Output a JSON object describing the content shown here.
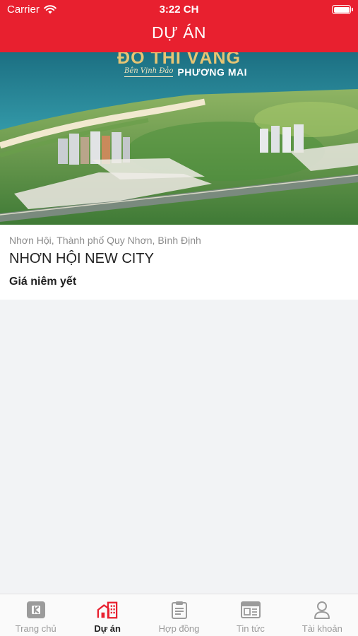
{
  "status_bar": {
    "carrier": "Carrier",
    "time": "3:22 CH"
  },
  "header": {
    "title": "DỰ ÁN"
  },
  "project": {
    "image_title": "ĐÔ THỊ VÀNG",
    "image_subtitle_script": "Bên Vịnh Đảo",
    "image_subtitle_name": "PHƯƠNG MAI",
    "location": "Nhơn Hội, Thành phố Quy Nhơn, Bình Định",
    "name": "NHƠN HỘI NEW CITY",
    "price_label": "Giá niêm yết"
  },
  "tabbar": {
    "items": [
      {
        "label": "Trang chủ",
        "icon": "home-icon",
        "active": false
      },
      {
        "label": "Dự án",
        "icon": "building-icon",
        "active": true
      },
      {
        "label": "Hợp đồng",
        "icon": "contract-icon",
        "active": false
      },
      {
        "label": "Tin tức",
        "icon": "news-icon",
        "active": false
      },
      {
        "label": "Tài khoản",
        "icon": "account-icon",
        "active": false
      }
    ],
    "active_color": "#e8202f",
    "inactive_color": "#9b9b9b"
  },
  "colors": {
    "header": "#e8202f",
    "background": "#f2f3f5"
  }
}
